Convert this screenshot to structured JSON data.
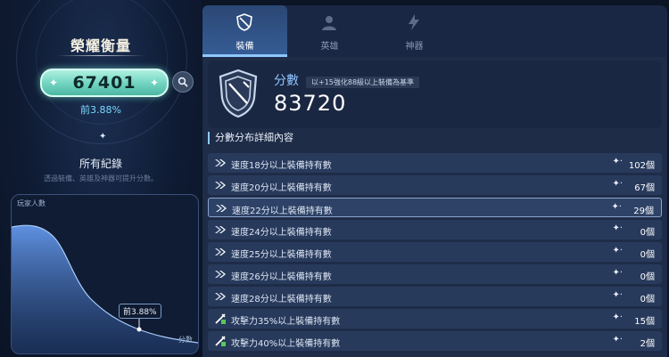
{
  "left": {
    "title": "榮耀衡量",
    "score": "67401",
    "rank": "前3.88%",
    "records_label": "所有紀錄",
    "records_sub": "透過裝備、英雄及神器可提升分數。",
    "chart": {
      "y_label": "玩家人數",
      "x_label": "分數",
      "marker_label": "前3.88%"
    }
  },
  "tabs": [
    {
      "label": "裝備",
      "icon": "equipment-icon",
      "active": true
    },
    {
      "label": "英雄",
      "icon": "hero-icon",
      "active": false
    },
    {
      "label": "神器",
      "icon": "artifact-icon",
      "active": false
    }
  ],
  "score_card": {
    "title": "分數",
    "badge": "以+15強化88級以上裝備為基準",
    "value": "83720"
  },
  "details": {
    "heading": "分數分布詳細內容",
    "rows": [
      {
        "label": "速度18分以上裝備持有數",
        "value": "102個",
        "icon": "speed-icon"
      },
      {
        "label": "速度20分以上裝備持有數",
        "value": "67個",
        "icon": "speed-icon"
      },
      {
        "label": "速度22分以上裝備持有數",
        "value": "29個",
        "icon": "speed-icon",
        "highlight": true
      },
      {
        "label": "速度24分以上裝備持有數",
        "value": "0個",
        "icon": "speed-icon"
      },
      {
        "label": "速度25分以上裝備持有數",
        "value": "0個",
        "icon": "speed-icon"
      },
      {
        "label": "速度26分以上裝備持有數",
        "value": "0個",
        "icon": "speed-icon"
      },
      {
        "label": "速度28分以上裝備持有數",
        "value": "0個",
        "icon": "speed-icon"
      },
      {
        "label": "攻擊力35%以上裝備持有數",
        "value": "15個",
        "icon": "attack-icon"
      },
      {
        "label": "攻擊力40%以上裝備持有數",
        "value": "2個",
        "icon": "attack-icon"
      }
    ]
  },
  "colors": {
    "accent": "#8ec8ff",
    "pill": "#6fd3bf",
    "panel": "#1e2c48"
  }
}
